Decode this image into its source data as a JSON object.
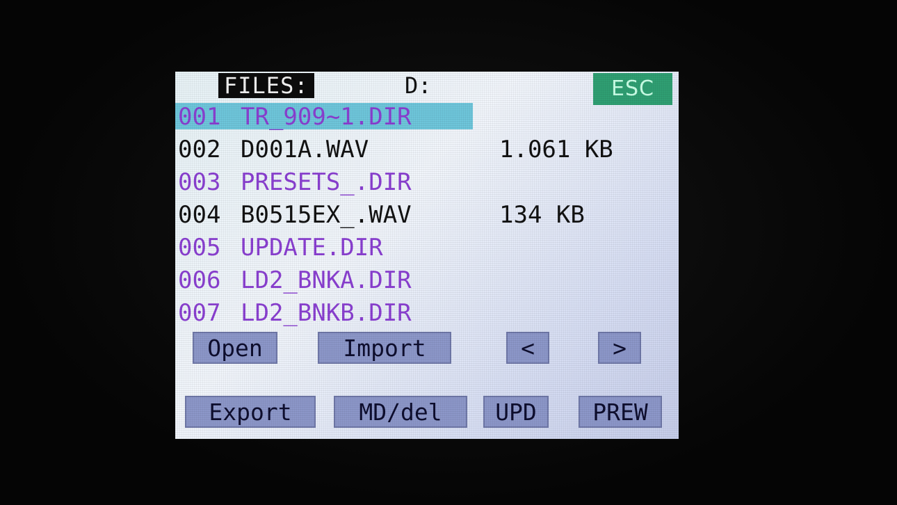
{
  "header": {
    "title": "FILES:",
    "drive": "D:",
    "esc_label": "ESC"
  },
  "files": [
    {
      "num": "001",
      "name": "TR_909~1.DIR",
      "size": "",
      "type": "dir",
      "selected": true
    },
    {
      "num": "002",
      "name": "D001A.WAV",
      "size": "1.061 KB",
      "type": "file",
      "selected": false
    },
    {
      "num": "003",
      "name": "PRESETS_.DIR",
      "size": "",
      "type": "dir",
      "selected": false
    },
    {
      "num": "004",
      "name": "B0515EX_.WAV",
      "size": "134 KB",
      "type": "file",
      "selected": false
    },
    {
      "num": "005",
      "name": "UPDATE.DIR",
      "size": "",
      "type": "dir",
      "selected": false
    },
    {
      "num": "006",
      "name": "LD2_BNKA.DIR",
      "size": "",
      "type": "dir",
      "selected": false
    },
    {
      "num": "007",
      "name": "LD2_BNKB.DIR",
      "size": "",
      "type": "dir",
      "selected": false
    }
  ],
  "buttons": {
    "open": "Open",
    "import": "Import",
    "prev": "<",
    "next": ">",
    "export": "Export",
    "mddel": "MD/del",
    "upd": "UPD",
    "prew": "PREW"
  },
  "colors": {
    "directory": "#8a3fd1",
    "file": "#121212",
    "selection": "#6ec6db",
    "button": "#8c97c9",
    "esc": "#2f9f73"
  }
}
